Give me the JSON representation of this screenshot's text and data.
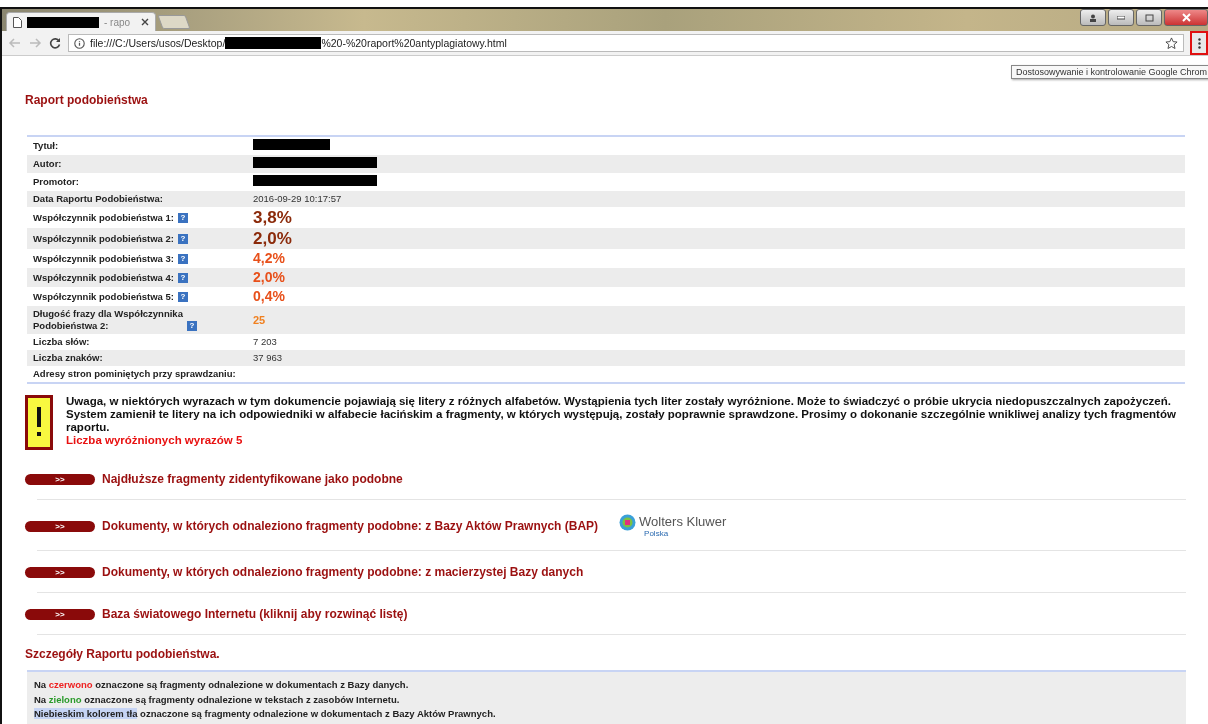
{
  "browser": {
    "tab": {
      "title": "- rapo"
    },
    "address": {
      "prefix": "file:///C:/Users/usos/Desktop/",
      "suffix": "%20-%20raport%20antyplagiatowy.html"
    },
    "tooltip": "Dostosowywanie i kontrolowanie Google Chrom"
  },
  "report": {
    "title": "Raport podobieństwa",
    "rows": [
      {
        "label": "Tytuł:",
        "kind": "redacted"
      },
      {
        "label": "Autor:",
        "kind": "redacted"
      },
      {
        "label": "Promotor:",
        "kind": "redacted"
      },
      {
        "label": "Data Raportu Podobieństwa:",
        "kind": "text",
        "value": "2016-09-29 10:17:57"
      },
      {
        "label": "Współczynnik podobieństwa 1:",
        "help": "?",
        "kind": "big-dark",
        "value": "3,8%"
      },
      {
        "label": "Współczynnik podobieństwa 2:",
        "help": "?",
        "kind": "big-dark",
        "value": "2,0%"
      },
      {
        "label": "Współczynnik podobieństwa 3:",
        "help": "?",
        "kind": "big-orange",
        "value": "4,2%"
      },
      {
        "label": "Współczynnik podobieństwa 4:",
        "help": "?",
        "kind": "big-orange",
        "value": "2,0%"
      },
      {
        "label": "Współczynnik podobieństwa 5:",
        "help": "?",
        "kind": "big-orange",
        "value": "0,4%"
      },
      {
        "label": "Długość frazy dla Współczynnika Podobieństwa 2:",
        "help": "?",
        "kind": "orange",
        "value": "25"
      },
      {
        "label": "Liczba słów:",
        "kind": "text",
        "value": "7 203"
      },
      {
        "label": "Liczba znaków:",
        "kind": "text",
        "value": "37 963"
      },
      {
        "label": "Adresy stron pominiętych przy sprawdzaniu:",
        "kind": "empty"
      }
    ],
    "warning": {
      "text": "Uwaga, w niektórych wyrazach w tym dokumencie pojawiają się litery z różnych alfabetów. Wystąpienia tych liter zostały wyróżnione. Może to świadczyć o próbie ukrycia niedopuszczalnych zapożyczeń. System zamienił te litery na ich odpowiedniki w alfabecie łacińskim a fragmenty, w których występują, zostały poprawnie sprawdzone. Prosimy o dokonanie szczególnie wnikliwej analizy tych fragmentów raportu.",
      "count": "Liczba wyróżnionych wyrazów 5"
    },
    "sections": [
      {
        "button": ">>",
        "title": "Najdłuższe fragmenty zidentyfikowane jako podobne"
      },
      {
        "button": ">>",
        "title": "Dokumenty, w których odnaleziono fragmenty podobne: z Bazy Aktów Prawnych (BAP)",
        "logo": {
          "name": "Wolters Kluwer",
          "sub": "Polska"
        }
      },
      {
        "button": ">>",
        "title": "Dokumenty, w których odnaleziono fragmenty podobne: z macierzystej Bazy danych"
      },
      {
        "button": ">>",
        "title": "Baza światowego Internetu (kliknij aby rozwinąć listę)"
      }
    ],
    "details": {
      "title": "Szczegóły Raportu podobieństwa.",
      "legend": [
        [
          {
            "kind": "plain",
            "text": "Na "
          },
          {
            "kind": "red",
            "text": "czerwono"
          },
          {
            "kind": "plain",
            "text": " oznaczone są fragmenty odnalezione w dokumentach z Bazy danych."
          }
        ],
        [
          {
            "kind": "plain",
            "text": "Na "
          },
          {
            "kind": "green",
            "text": "zielono"
          },
          {
            "kind": "plain",
            "text": " oznaczone są fragmenty odnalezione w tekstach z zasobów Internetu."
          }
        ],
        [
          {
            "kind": "blue-bg",
            "text": "Niebieskim kolorem tła"
          },
          {
            "kind": "plain",
            "text": " oznaczone są fragmenty odnalezione w dokumentach z Bazy Aktów Prawnych."
          }
        ]
      ]
    }
  }
}
